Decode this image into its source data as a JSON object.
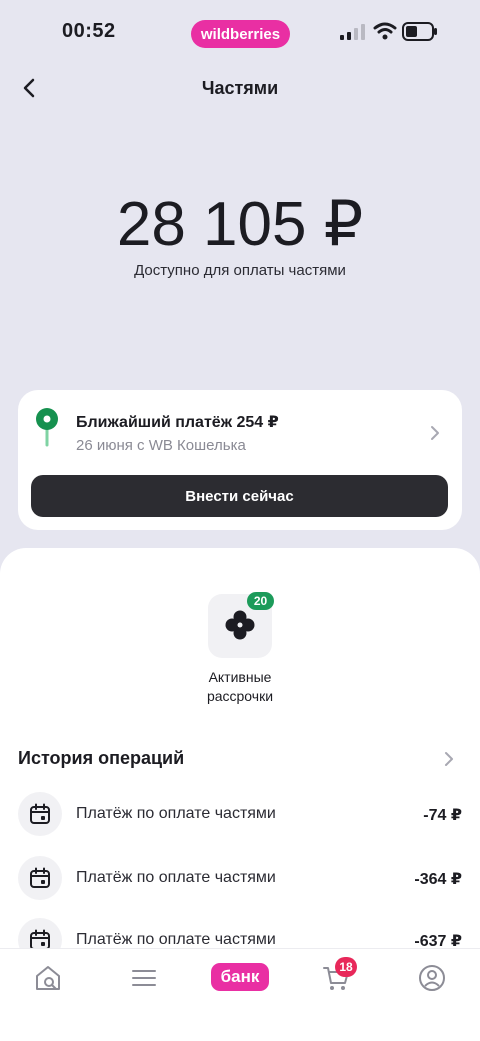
{
  "status_bar": {
    "time": "00:52",
    "brand": "wildberries"
  },
  "header": {
    "title": "Частями"
  },
  "balance": {
    "amount": "28 105 ₽",
    "caption": "Доступно для оплаты частями"
  },
  "payment_card": {
    "title": "Ближайший платёж 254 ₽",
    "subtitle": "26 июня с WB Кошелька",
    "button_label": "Внести сейчас"
  },
  "installments": {
    "badge_count": "20",
    "label_line1": "Активные",
    "label_line2": "рассрочки"
  },
  "history": {
    "title": "История операций",
    "operations": [
      {
        "label": "Платёж по оплате частями",
        "amount": "-74 ₽"
      },
      {
        "label": "Платёж по оплате частями",
        "amount": "-364 ₽"
      },
      {
        "label": "Платёж по оплате частями",
        "amount": "-637 ₽"
      }
    ]
  },
  "bottom_nav": {
    "bank_label": "банк",
    "cart_badge": "18"
  },
  "colors": {
    "brand_pink": "#e92fa3",
    "background": "#e6e6f0",
    "button_dark": "#2c2c31",
    "success_green": "#1c9b5a",
    "badge_red": "#e8285a"
  },
  "icons": {
    "back": "chevron-left-icon",
    "pin": "map-pin-icon",
    "installments": "clover-icon",
    "operation": "calendar-icon",
    "nav": [
      "home-search-icon",
      "catalog-menu-icon",
      "bank-icon",
      "cart-icon",
      "profile-icon"
    ]
  }
}
